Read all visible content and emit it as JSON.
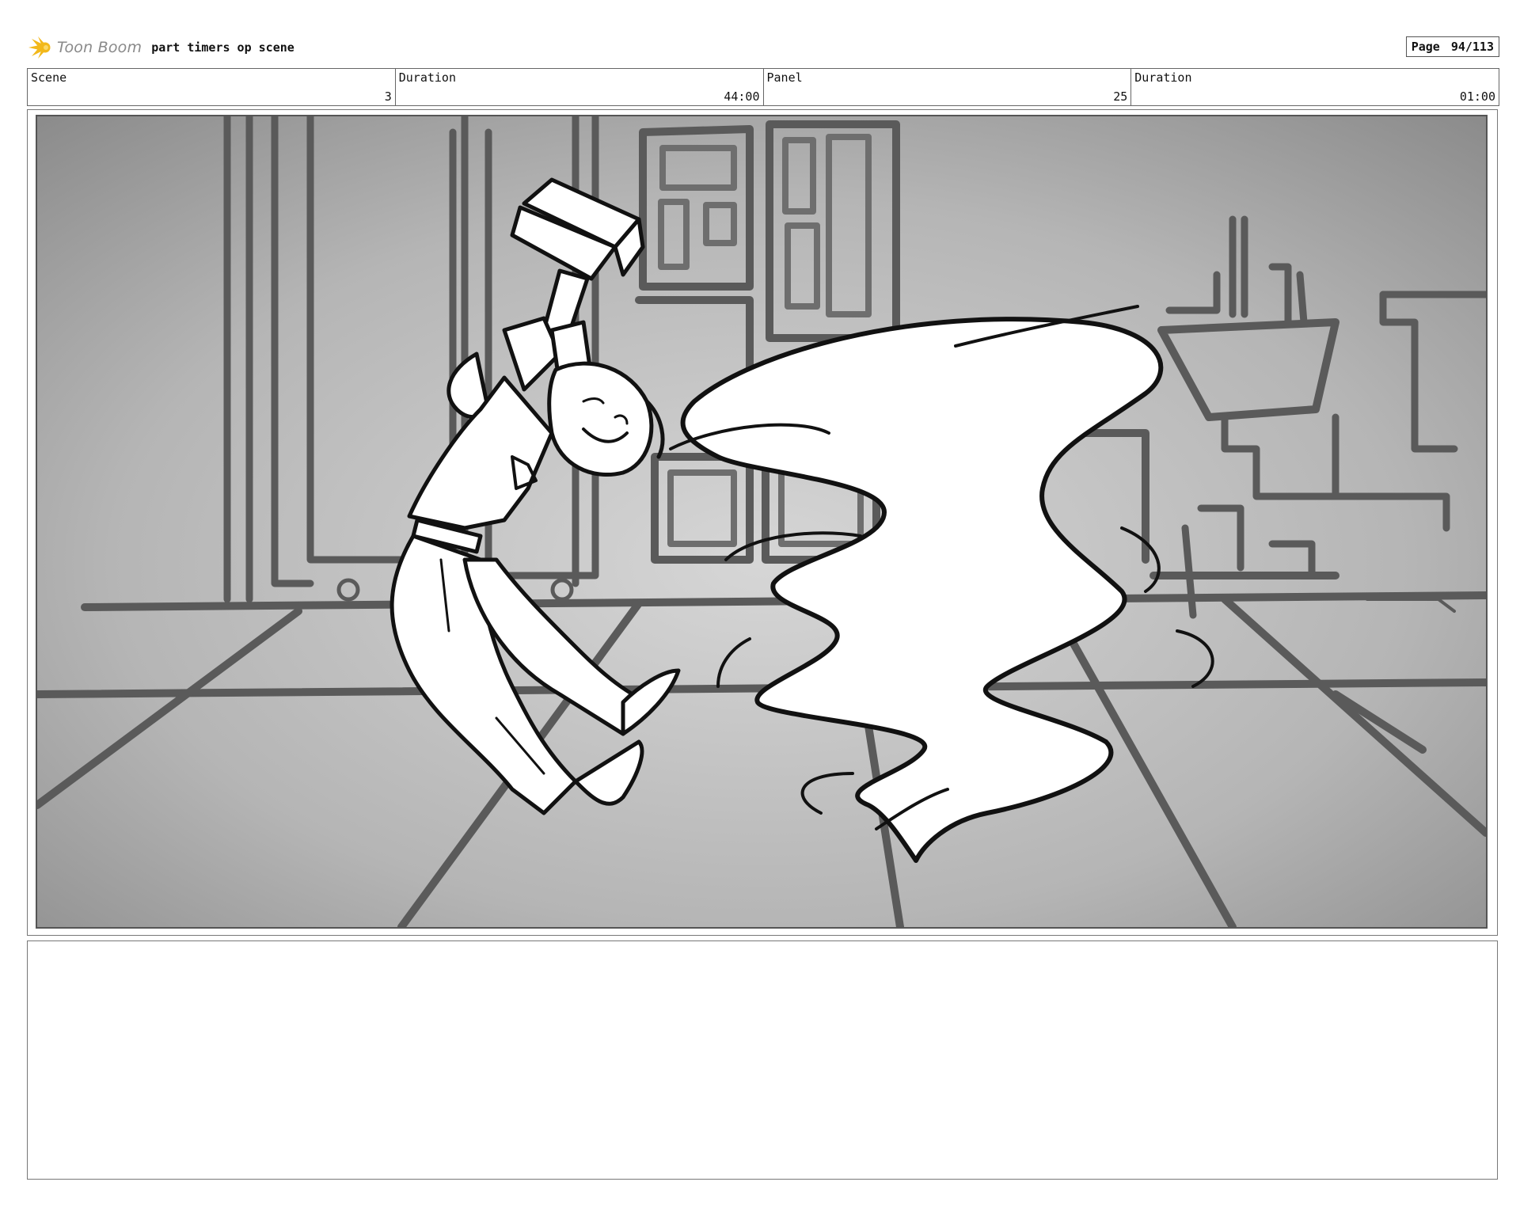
{
  "header": {
    "logo_text": "Toon Boom",
    "project_title": "part timers op scene",
    "page_label": "Page",
    "page_value": "94/113"
  },
  "info": {
    "scene_label": "Scene",
    "scene_value": "3",
    "scene_duration_label": "Duration",
    "scene_duration_value": "44:00",
    "panel_label": "Panel",
    "panel_value": "25",
    "panel_duration_label": "Duration",
    "panel_duration_value": "01:00"
  },
  "colors": {
    "logo_accent": "#f2b81a",
    "line_dark": "#111111",
    "line_background": "#5a5a5a"
  }
}
